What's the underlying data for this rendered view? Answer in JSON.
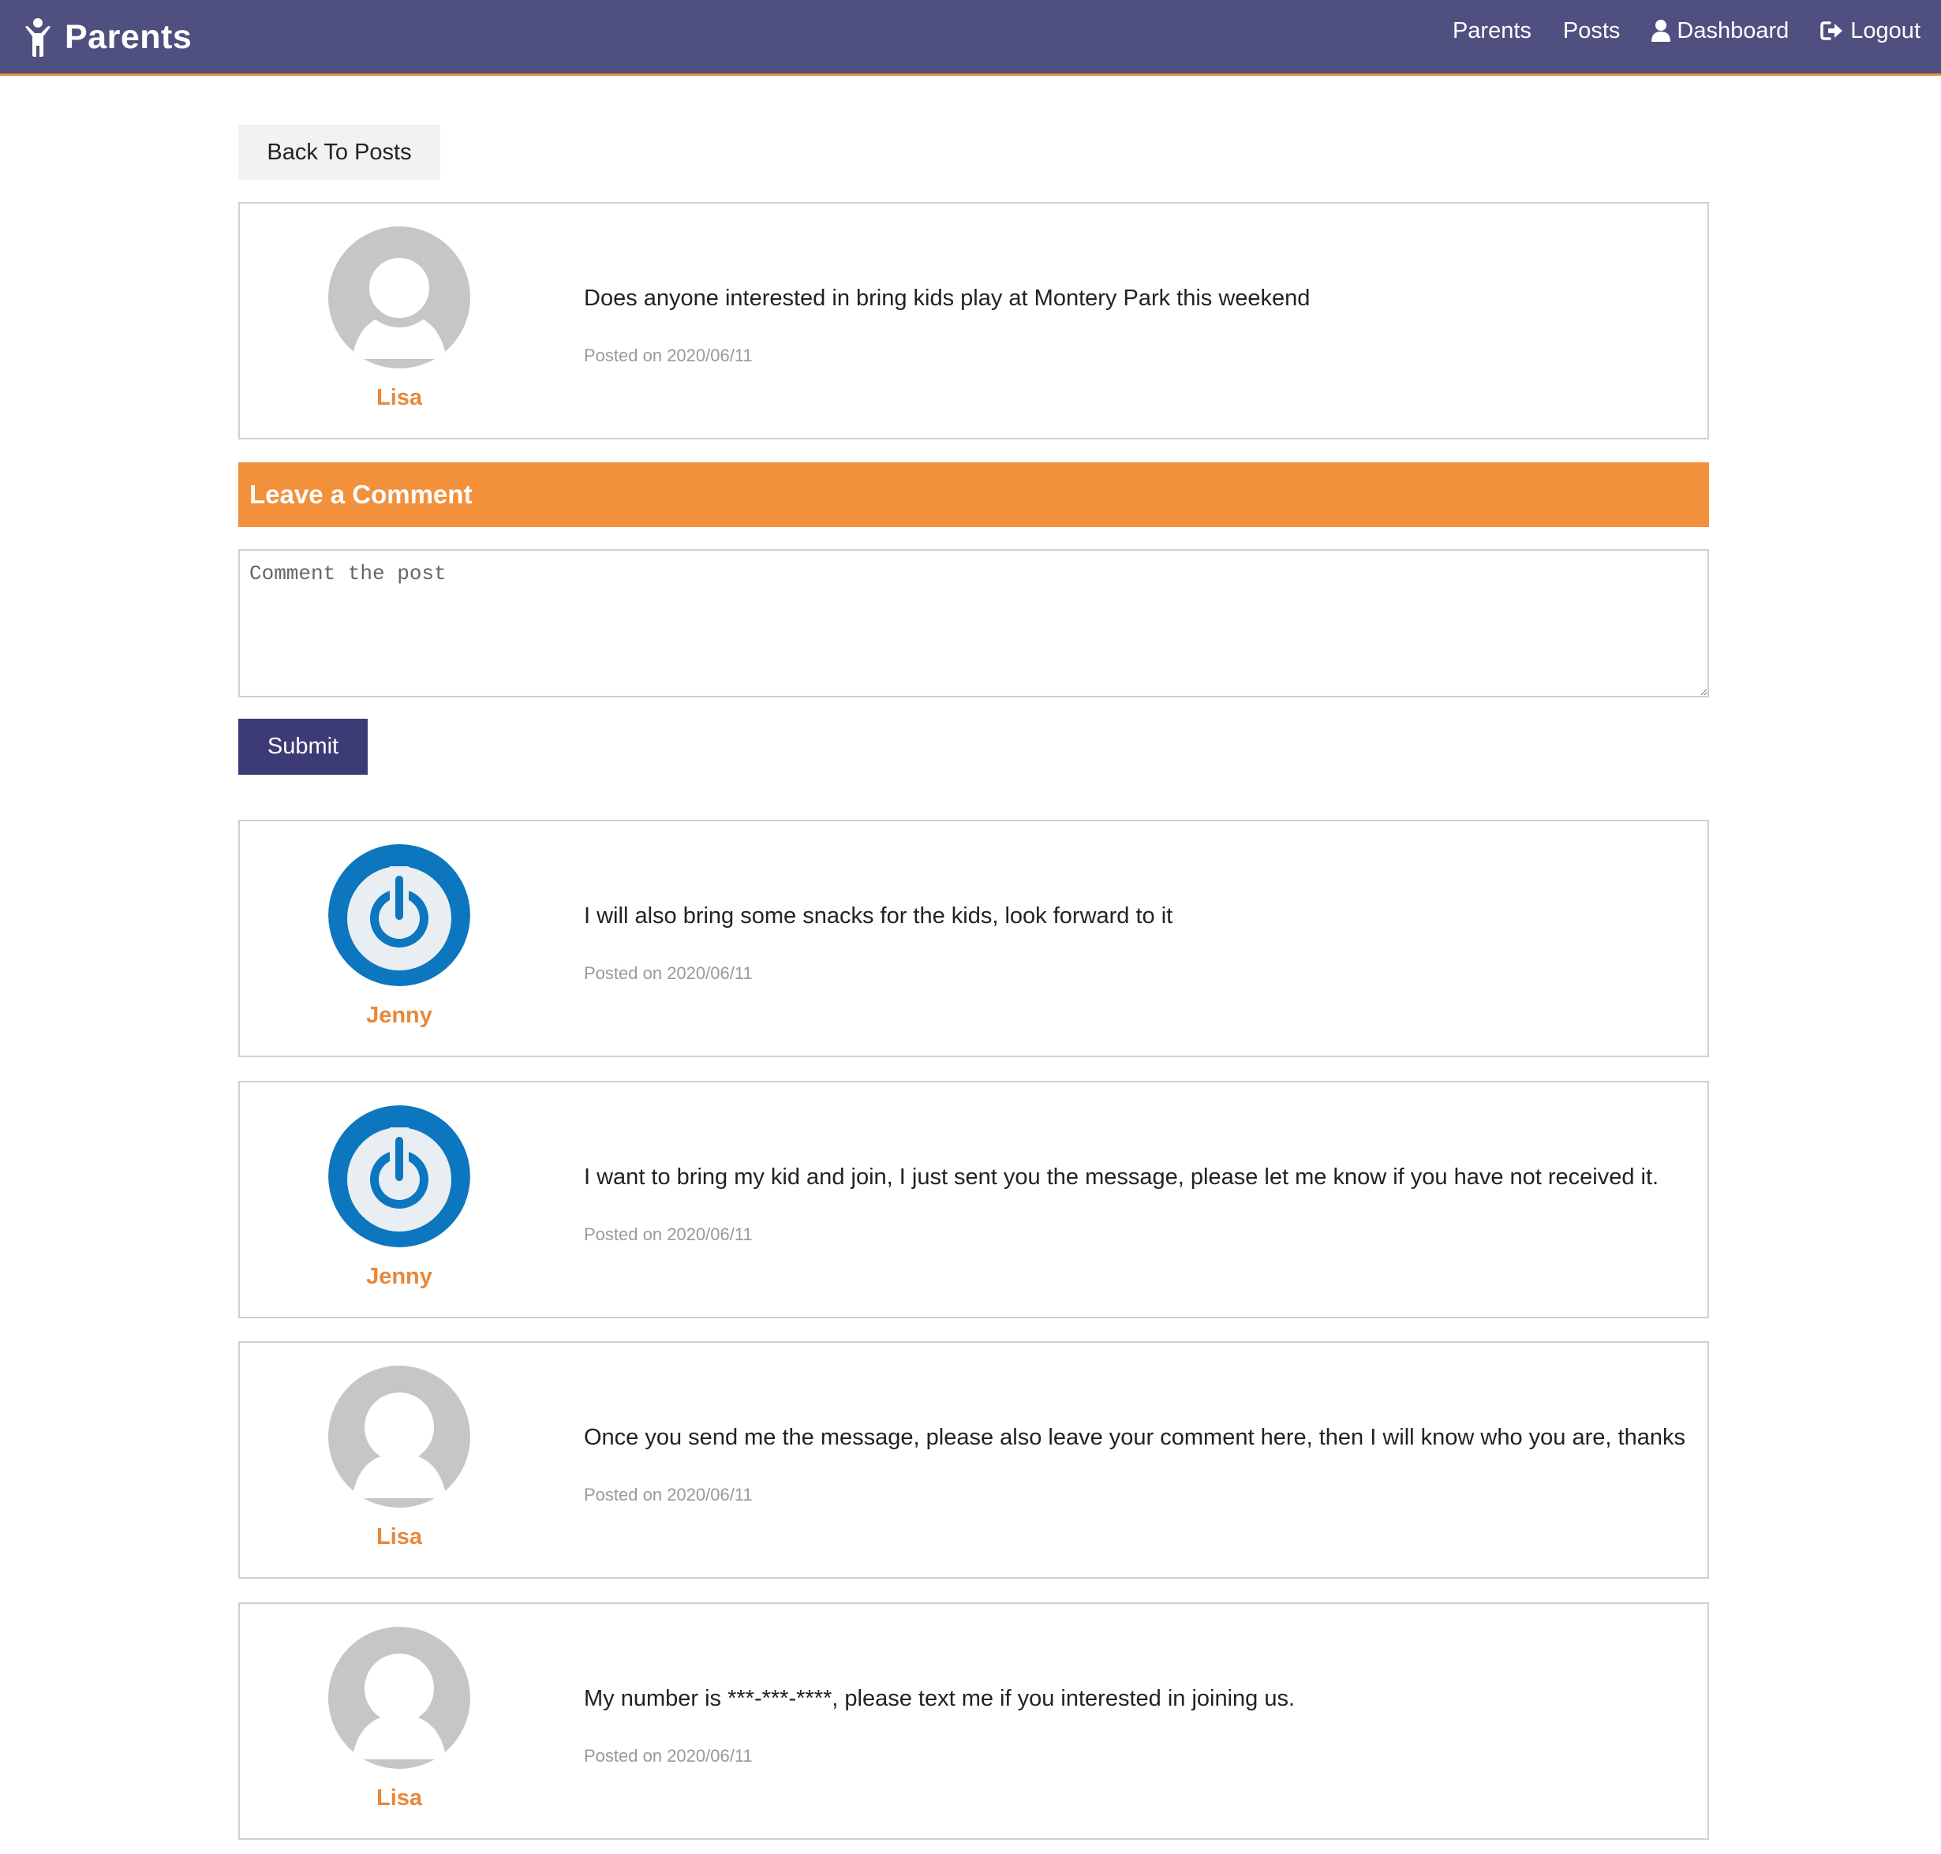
{
  "navbar": {
    "brand": "Parents",
    "links": {
      "parents": "Parents",
      "posts": "Posts",
      "dashboard": "Dashboard",
      "logout": "Logout"
    }
  },
  "back_button": "Back To Posts",
  "post": {
    "author": "Lisa",
    "avatar": "default-avatar",
    "text": "Does anyone interested in bring kids play at Montery Park this weekend",
    "date": "Posted on 2020/06/11"
  },
  "comment_form": {
    "heading": "Leave a Comment",
    "placeholder": "Comment the post",
    "submit": "Submit"
  },
  "comments": [
    {
      "author": "Jenny",
      "avatar": "power-avatar",
      "text": "I will also bring some snacks for the kids, look forward to it",
      "date": "Posted on 2020/06/11"
    },
    {
      "author": "Jenny",
      "avatar": "power-avatar",
      "text": "I want to bring my kid and join, I just sent you the message, please let me know if you have not received it.",
      "date": "Posted on 2020/06/11"
    },
    {
      "author": "Lisa",
      "avatar": "default-avatar",
      "text": "Once you send me the message, please also leave your comment here, then I will know who you are, thanks",
      "date": "Posted on 2020/06/11"
    },
    {
      "author": "Lisa",
      "avatar": "default-avatar",
      "text": "My number is ***-***-****, please text me if you interested in joining us.",
      "date": "Posted on 2020/06/11"
    }
  ],
  "colors": {
    "navbar": "#4f4f80",
    "accent": "#f2903c",
    "author": "#e8883a",
    "submit": "#3d3b75",
    "power_avatar": "#0c76be"
  }
}
